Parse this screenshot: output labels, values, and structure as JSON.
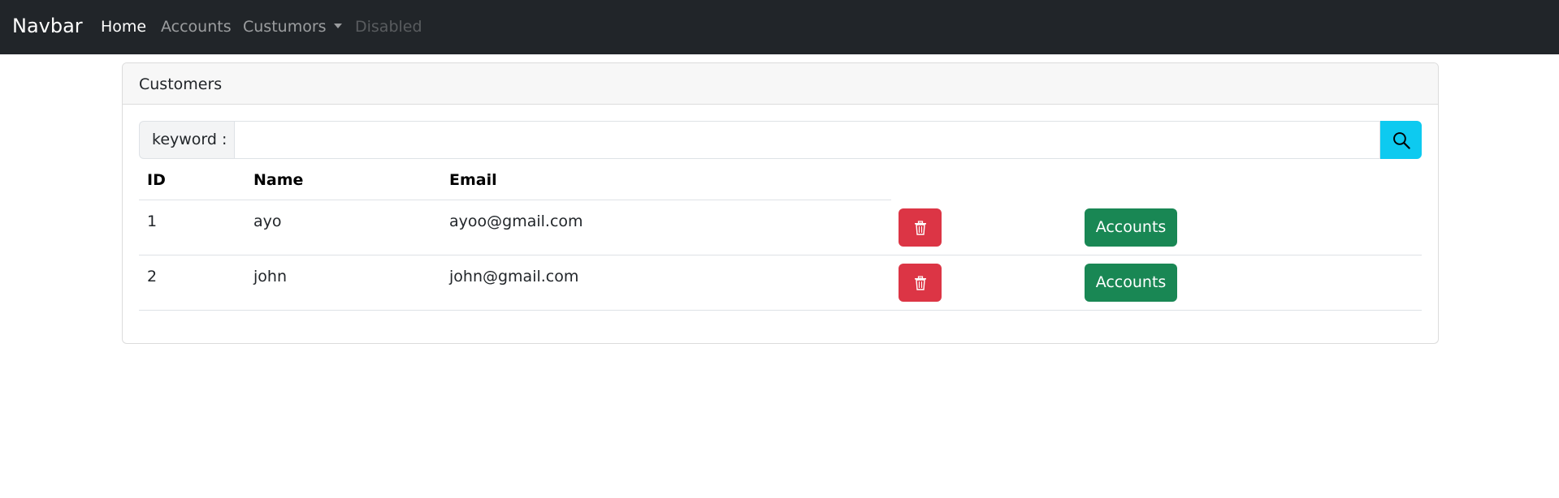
{
  "navbar": {
    "brand": "Navbar",
    "links": [
      {
        "label": "Home"
      },
      {
        "label": "Accounts"
      },
      {
        "label": "Custumors"
      },
      {
        "label": "Disabled"
      }
    ]
  },
  "card": {
    "title": "Customers",
    "search": {
      "label": "keyword :",
      "value": "",
      "placeholder": "",
      "button_icon": "search-icon"
    },
    "table": {
      "columns": [
        "ID",
        "Name",
        "Email"
      ],
      "rows": [
        {
          "id": "1",
          "name": "ayo",
          "email": "ayoo@gmail.com",
          "delete_icon": "trash-icon",
          "accounts_label": "Accounts"
        },
        {
          "id": "2",
          "name": "john",
          "email": "john@gmail.com",
          "delete_icon": "trash-icon",
          "accounts_label": "Accounts"
        }
      ]
    }
  },
  "colors": {
    "navbar_bg": "#212529",
    "search_button": "#0dcaf0",
    "delete_button": "#dc3545",
    "accounts_button": "#198754"
  }
}
